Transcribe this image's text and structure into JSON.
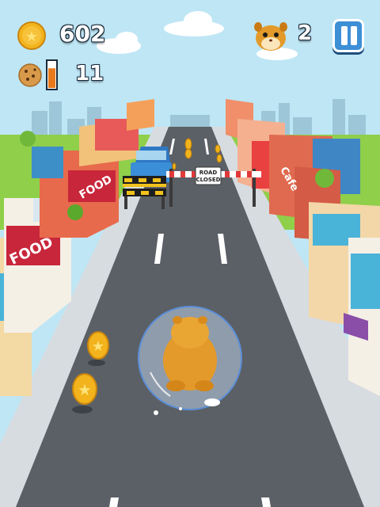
{
  "hud": {
    "coins": "602",
    "cookies": "11",
    "lives": "2",
    "cookie_meter_fill": 0.75
  },
  "road_sign": {
    "line1": "ROAD",
    "line2": "CLOSED"
  },
  "shop_signs": {
    "food_left": "FOOD",
    "food_mid": "FOOD",
    "cafe_right": "Cafe"
  },
  "icons": {
    "coin": "coin-icon",
    "cookie": "cookie-icon",
    "hamster": "hamster-face-icon",
    "pause": "pause-icon"
  },
  "colors": {
    "sky": "#bfe6f5",
    "grass": "#8fcf4a",
    "road": "#5b6066",
    "coin": "#f2b31c",
    "pause": "#3d8fd6"
  }
}
